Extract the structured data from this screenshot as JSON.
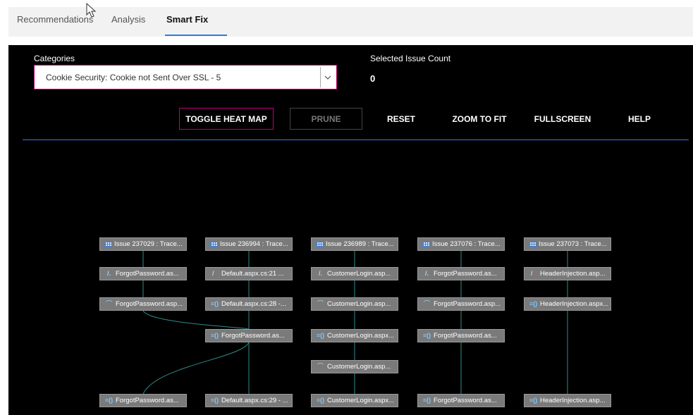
{
  "tabs": [
    {
      "label": "Recommendations"
    },
    {
      "label": "Analysis"
    },
    {
      "label": "Smart Fix"
    }
  ],
  "filters": {
    "categories_label": "Categories",
    "categories_value": "Cookie Security: Cookie not Sent Over SSL - 5",
    "selected_count_label": "Selected Issue Count",
    "selected_count_value": "0"
  },
  "toolbar": {
    "toggle_heat_map": "TOGGLE HEAT MAP",
    "prune": "PRUNE",
    "reset": "RESET",
    "zoom_to_fit": "ZOOM TO FIT",
    "fullscreen": "FULLSCREEN",
    "help": "HELP"
  },
  "graph": {
    "columns": [
      {
        "nodes": [
          {
            "icon": "table-icon",
            "label": "Issue 237029 : Trace..."
          },
          {
            "icon": "slash-icon",
            "label": "ForgotPassword.as..."
          },
          {
            "icon": "source-icon",
            "label": "ForgotPassword.asp..."
          },
          {
            "icon": "function-icon",
            "label": "ForgotPassword.as..."
          }
        ]
      },
      {
        "nodes": [
          {
            "icon": "table-icon",
            "label": "Issue 236994 : Trace..."
          },
          {
            "icon": "sink-icon",
            "label": "Default.aspx.cs:21 ..."
          },
          {
            "icon": "function-icon",
            "label": "Default.aspx.cs:28 -..."
          },
          {
            "icon": "function-icon",
            "label": "ForgotPassword.as..."
          },
          {
            "icon": "function-icon",
            "label": "Default.aspx.cs:29 - ..."
          }
        ]
      },
      {
        "nodes": [
          {
            "icon": "table-icon",
            "label": "Issue 236989 : Trace..."
          },
          {
            "icon": "slash-icon",
            "label": "CustomerLogin.asp..."
          },
          {
            "icon": "source-icon",
            "label": "CustomerLogin.asp..."
          },
          {
            "icon": "function-icon",
            "label": "CustomerLogin.aspx..."
          },
          {
            "icon": "source-icon",
            "label": "CustomerLogin.asp..."
          },
          {
            "icon": "function-icon",
            "label": "CustomerLogin.aspx..."
          }
        ]
      },
      {
        "nodes": [
          {
            "icon": "table-icon",
            "label": "Issue 237076 : Trace..."
          },
          {
            "icon": "slash-icon",
            "label": "ForgotPassword.as..."
          },
          {
            "icon": "source-icon",
            "label": "ForgotPassword.asp..."
          },
          {
            "icon": "function-icon",
            "label": "ForgotPassword.as..."
          },
          {
            "icon": "function-icon",
            "label": "ForgotPassword.as..."
          }
        ]
      },
      {
        "nodes": [
          {
            "icon": "table-icon",
            "label": "Issue 237073 : Trace..."
          },
          {
            "icon": "sink-icon",
            "label": "HeaderInjection.asp..."
          },
          {
            "icon": "function-icon",
            "label": "HeaderInjection.aspx..."
          },
          {
            "icon": "function-icon",
            "label": "HeaderInjection.asp..."
          }
        ]
      }
    ],
    "colors": {
      "panel": "#000000",
      "node": "#7a7a7a",
      "edge": "#2e8b8b",
      "accent": "#c3007a",
      "divider": "#2a7de1"
    }
  }
}
